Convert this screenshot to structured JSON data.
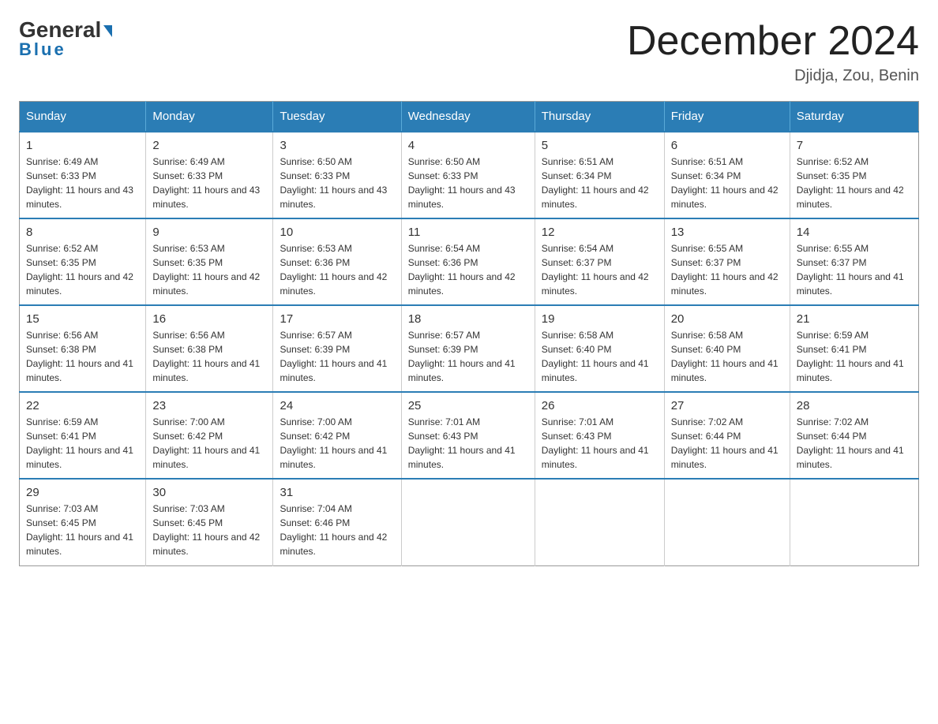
{
  "header": {
    "logo_general": "General",
    "logo_blue": "Blue",
    "title": "December 2024",
    "location": "Djidja, Zou, Benin"
  },
  "days_of_week": [
    "Sunday",
    "Monday",
    "Tuesday",
    "Wednesday",
    "Thursday",
    "Friday",
    "Saturday"
  ],
  "weeks": [
    [
      {
        "day": "1",
        "sunrise": "6:49 AM",
        "sunset": "6:33 PM",
        "daylight": "11 hours and 43 minutes."
      },
      {
        "day": "2",
        "sunrise": "6:49 AM",
        "sunset": "6:33 PM",
        "daylight": "11 hours and 43 minutes."
      },
      {
        "day": "3",
        "sunrise": "6:50 AM",
        "sunset": "6:33 PM",
        "daylight": "11 hours and 43 minutes."
      },
      {
        "day": "4",
        "sunrise": "6:50 AM",
        "sunset": "6:33 PM",
        "daylight": "11 hours and 43 minutes."
      },
      {
        "day": "5",
        "sunrise": "6:51 AM",
        "sunset": "6:34 PM",
        "daylight": "11 hours and 42 minutes."
      },
      {
        "day": "6",
        "sunrise": "6:51 AM",
        "sunset": "6:34 PM",
        "daylight": "11 hours and 42 minutes."
      },
      {
        "day": "7",
        "sunrise": "6:52 AM",
        "sunset": "6:35 PM",
        "daylight": "11 hours and 42 minutes."
      }
    ],
    [
      {
        "day": "8",
        "sunrise": "6:52 AM",
        "sunset": "6:35 PM",
        "daylight": "11 hours and 42 minutes."
      },
      {
        "day": "9",
        "sunrise": "6:53 AM",
        "sunset": "6:35 PM",
        "daylight": "11 hours and 42 minutes."
      },
      {
        "day": "10",
        "sunrise": "6:53 AM",
        "sunset": "6:36 PM",
        "daylight": "11 hours and 42 minutes."
      },
      {
        "day": "11",
        "sunrise": "6:54 AM",
        "sunset": "6:36 PM",
        "daylight": "11 hours and 42 minutes."
      },
      {
        "day": "12",
        "sunrise": "6:54 AM",
        "sunset": "6:37 PM",
        "daylight": "11 hours and 42 minutes."
      },
      {
        "day": "13",
        "sunrise": "6:55 AM",
        "sunset": "6:37 PM",
        "daylight": "11 hours and 42 minutes."
      },
      {
        "day": "14",
        "sunrise": "6:55 AM",
        "sunset": "6:37 PM",
        "daylight": "11 hours and 41 minutes."
      }
    ],
    [
      {
        "day": "15",
        "sunrise": "6:56 AM",
        "sunset": "6:38 PM",
        "daylight": "11 hours and 41 minutes."
      },
      {
        "day": "16",
        "sunrise": "6:56 AM",
        "sunset": "6:38 PM",
        "daylight": "11 hours and 41 minutes."
      },
      {
        "day": "17",
        "sunrise": "6:57 AM",
        "sunset": "6:39 PM",
        "daylight": "11 hours and 41 minutes."
      },
      {
        "day": "18",
        "sunrise": "6:57 AM",
        "sunset": "6:39 PM",
        "daylight": "11 hours and 41 minutes."
      },
      {
        "day": "19",
        "sunrise": "6:58 AM",
        "sunset": "6:40 PM",
        "daylight": "11 hours and 41 minutes."
      },
      {
        "day": "20",
        "sunrise": "6:58 AM",
        "sunset": "6:40 PM",
        "daylight": "11 hours and 41 minutes."
      },
      {
        "day": "21",
        "sunrise": "6:59 AM",
        "sunset": "6:41 PM",
        "daylight": "11 hours and 41 minutes."
      }
    ],
    [
      {
        "day": "22",
        "sunrise": "6:59 AM",
        "sunset": "6:41 PM",
        "daylight": "11 hours and 41 minutes."
      },
      {
        "day": "23",
        "sunrise": "7:00 AM",
        "sunset": "6:42 PM",
        "daylight": "11 hours and 41 minutes."
      },
      {
        "day": "24",
        "sunrise": "7:00 AM",
        "sunset": "6:42 PM",
        "daylight": "11 hours and 41 minutes."
      },
      {
        "day": "25",
        "sunrise": "7:01 AM",
        "sunset": "6:43 PM",
        "daylight": "11 hours and 41 minutes."
      },
      {
        "day": "26",
        "sunrise": "7:01 AM",
        "sunset": "6:43 PM",
        "daylight": "11 hours and 41 minutes."
      },
      {
        "day": "27",
        "sunrise": "7:02 AM",
        "sunset": "6:44 PM",
        "daylight": "11 hours and 41 minutes."
      },
      {
        "day": "28",
        "sunrise": "7:02 AM",
        "sunset": "6:44 PM",
        "daylight": "11 hours and 41 minutes."
      }
    ],
    [
      {
        "day": "29",
        "sunrise": "7:03 AM",
        "sunset": "6:45 PM",
        "daylight": "11 hours and 41 minutes."
      },
      {
        "day": "30",
        "sunrise": "7:03 AM",
        "sunset": "6:45 PM",
        "daylight": "11 hours and 42 minutes."
      },
      {
        "day": "31",
        "sunrise": "7:04 AM",
        "sunset": "6:46 PM",
        "daylight": "11 hours and 42 minutes."
      },
      null,
      null,
      null,
      null
    ]
  ]
}
